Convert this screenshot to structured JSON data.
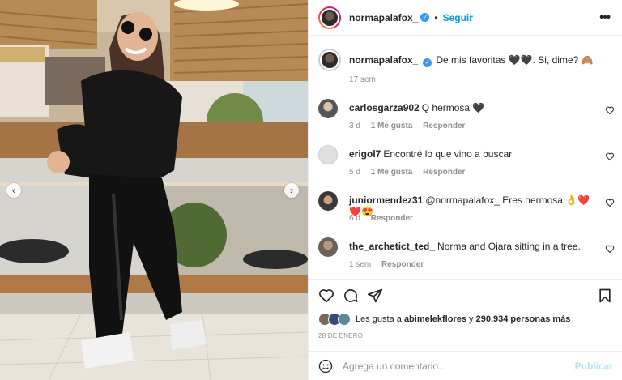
{
  "post": {
    "author": "normapalafox_",
    "follow_label": "Seguir",
    "separator": "•",
    "more_icon": "•••",
    "verified_icon": "✓"
  },
  "caption": {
    "user": "normapalafox_",
    "text": "De mis favoritas 🖤🖤. Si, dime? 🙈",
    "time": "17 sem"
  },
  "comments": [
    {
      "user": "carlosgarza902",
      "text": "Q hermosa 🖤",
      "time": "3 d",
      "likes": "1 Me gusta",
      "reply": "Responder"
    },
    {
      "user": "erigol7",
      "text": "Encontré lo que vino a buscar",
      "time": "5 d",
      "likes": "1 Me gusta",
      "reply": "Responder"
    },
    {
      "user": "juniormendez31",
      "text": "@normapalafox_ Eres hermosa 👌❤️❤️😍",
      "time": "6 d",
      "likes": "",
      "reply": "Responder"
    },
    {
      "user": "the_archetict_ted_",
      "text": "Norma and Ojara sitting in a tree.",
      "time": "1 sem",
      "likes": "",
      "reply": "Responder"
    }
  ],
  "likes": {
    "prefix": "Les gusta a",
    "user": "abimelekflores",
    "connector": "y",
    "count": "290,934 personas más"
  },
  "date": "28 DE ENERO",
  "add_comment": {
    "placeholder": "Agrega un comentario...",
    "publish_label": "Publicar"
  },
  "carousel": {
    "prev_icon": "‹",
    "next_icon": "›"
  },
  "colors": {
    "accent": "#0095f6",
    "verified": "#3897f0",
    "publish_disabled": "#b2dffc",
    "meta": "#8e8e8e"
  },
  "icons": [
    "heart-icon",
    "comment-icon",
    "share-icon",
    "bookmark-icon",
    "emoji-icon",
    "more-icon",
    "verified-icon"
  ]
}
